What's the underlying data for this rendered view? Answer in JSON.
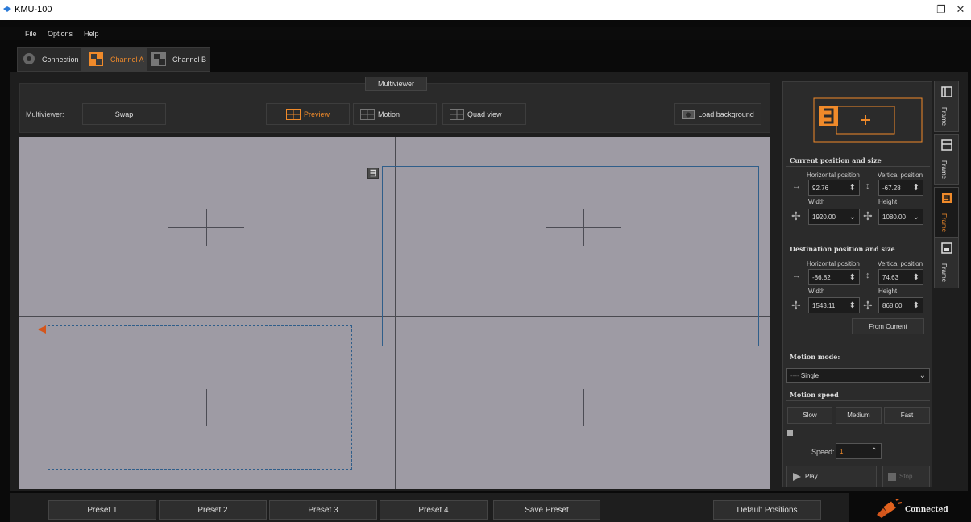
{
  "window": {
    "title": "KMU-100",
    "minimize_glyph": "–",
    "restore_glyph": "❐",
    "close_glyph": "✕"
  },
  "menu": {
    "items": [
      "File",
      "Options",
      "Help"
    ]
  },
  "tabs": [
    {
      "label": "Connection",
      "icon": "gear-icon"
    },
    {
      "label": "Channel A",
      "icon": "channel-a-icon"
    },
    {
      "label": "Channel B",
      "icon": "channel-b-icon"
    }
  ],
  "multiviewer": {
    "tab_label": "Multiviewer",
    "label": "Multiviewer:",
    "swap": "Swap",
    "preview": "Preview",
    "motion": "Motion",
    "quad_view": "Quad view",
    "load_background": "Load background"
  },
  "right_panel": {
    "current_section": "Current position and size",
    "dest_section": "Destination position and size",
    "h_pos_label": "Horizontal position",
    "v_pos_label": "Vertical position",
    "width_label": "Width",
    "height_label": "Height",
    "current": {
      "h": "92.76",
      "v": "-67.28",
      "w": "1920.00",
      "h2": "1080.00"
    },
    "dest": {
      "h": "-86.82",
      "v": "74.63",
      "w": "1543.11",
      "h2": "868.00"
    },
    "from_current": "From Current",
    "motion_mode_section": "Motion mode:",
    "motion_mode_value": "Single",
    "motion_speed_section": "Motion speed",
    "slow": "Slow",
    "medium": "Medium",
    "fast": "Fast",
    "speed_label": "Speed:",
    "speed_value": "1",
    "play": "Play",
    "stop": "Stop"
  },
  "side_tabs": [
    "Frame",
    "Frame",
    "Frame",
    "Frame"
  ],
  "presets": [
    "Preset 1",
    "Preset 2",
    "Preset 3",
    "Preset 4"
  ],
  "save_preset": "Save Preset",
  "default_positions": "Default Positions",
  "status": "Connected",
  "colors": {
    "accent": "#f08a2a",
    "frame_blue": "#2f5e8a"
  }
}
